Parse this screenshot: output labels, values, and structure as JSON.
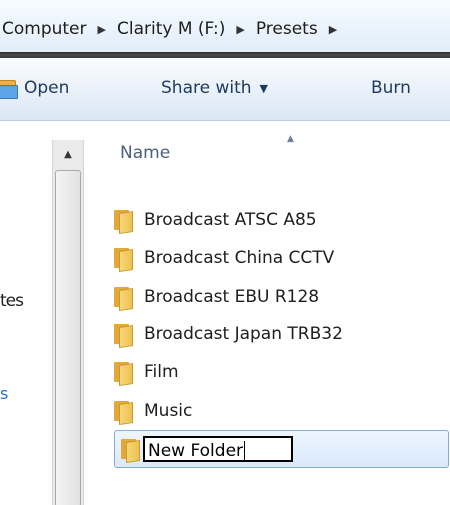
{
  "addressbar": {
    "crumbs": [
      "Computer",
      "Clarity M (F:)",
      "Presets"
    ]
  },
  "toolbar": {
    "open_label": "Open",
    "share_label": "Share with",
    "burn_label": "Burn"
  },
  "navpane": {
    "partial_item_1": "tes",
    "partial_item_2": "s"
  },
  "list": {
    "column_name": "Name",
    "items": [
      "Broadcast ATSC A85",
      "Broadcast China CCTV",
      "Broadcast EBU R128",
      "Broadcast Japan TRB32",
      "Film",
      "Music"
    ],
    "rename_value": "New Folder"
  },
  "colors": {
    "selection_border": "#84acdd",
    "selection_fill": "#d9e9fb",
    "folder": "#edc24d"
  }
}
